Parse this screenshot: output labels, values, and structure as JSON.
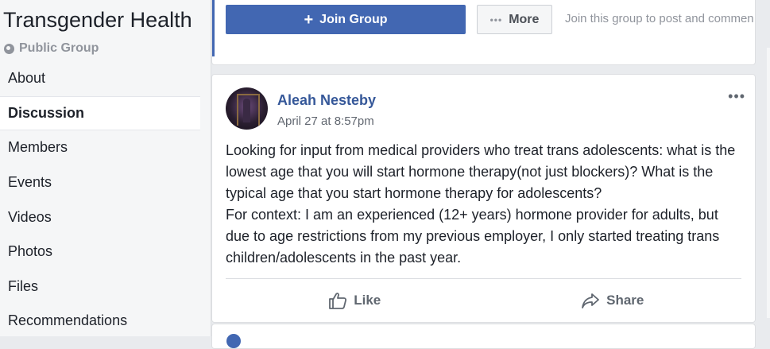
{
  "group": {
    "title": "Transgender Health",
    "type_label": "Public Group",
    "type_icon": "globe-icon"
  },
  "nav": {
    "items": [
      {
        "label": "About",
        "active": false
      },
      {
        "label": "Discussion",
        "active": true
      },
      {
        "label": "Members",
        "active": false
      },
      {
        "label": "Events",
        "active": false
      },
      {
        "label": "Videos",
        "active": false
      },
      {
        "label": "Photos",
        "active": false
      },
      {
        "label": "Files",
        "active": false
      },
      {
        "label": "Recommendations",
        "active": false
      }
    ]
  },
  "actionbar": {
    "join_label": "Join Group",
    "join_icon": "plus-icon",
    "more_label": "More",
    "more_icon": "ellipsis-icon",
    "hint": "Join this group to post and commen"
  },
  "post": {
    "author": "Aleah Nesteby",
    "timestamp": "April 27 at 8:57pm",
    "paragraph1": "Looking for input from medical providers who treat trans adolescents: what is the lowest age that you will start hormone therapy(not just blockers)? What is the typical age that you start hormone therapy for adolescents?",
    "paragraph2": "For context: I am an experienced (12+ years) hormone provider for adults, but due to age restrictions from my previous employer, I only started treating trans children/adolescents in the past year.",
    "like_label": "Like",
    "share_label": "Share"
  },
  "colors": {
    "brand": "#4267b2",
    "author_link": "#365899",
    "background": "#e9ebee"
  }
}
